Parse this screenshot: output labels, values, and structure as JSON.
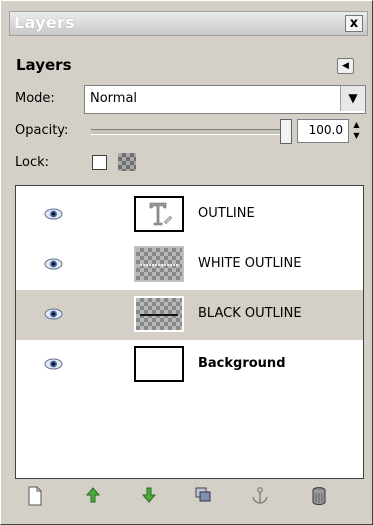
{
  "window": {
    "title": "Layers",
    "close": "x"
  },
  "panel": {
    "heading": "Layers"
  },
  "mode": {
    "label": "Mode:",
    "value": "Normal"
  },
  "opacity": {
    "label": "Opacity:",
    "value": "100.0",
    "level": 1.0
  },
  "lock": {
    "label": "Lock:",
    "checked": false
  },
  "layers": [
    {
      "name": "OUTLINE",
      "visible": true,
      "thumb": "text-icon",
      "selected": false
    },
    {
      "name": "WHITE OUTLINE",
      "visible": true,
      "thumb": "checker-white",
      "selected": false
    },
    {
      "name": "BLACK OUTLINE",
      "visible": true,
      "thumb": "checker-black",
      "selected": true
    },
    {
      "name": "Background",
      "visible": true,
      "thumb": "white",
      "selected": false
    }
  ],
  "toolbar": [
    "new-layer-icon",
    "raise-layer-icon",
    "lower-layer-icon",
    "duplicate-layer-icon",
    "anchor-layer-icon",
    "delete-layer-icon"
  ]
}
